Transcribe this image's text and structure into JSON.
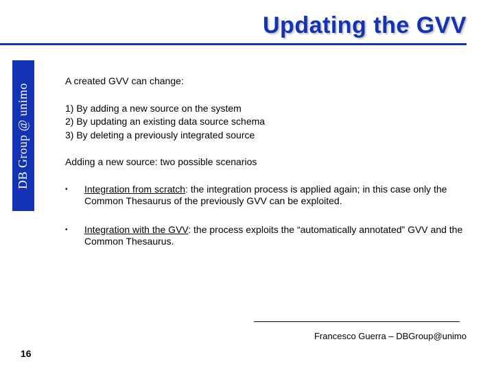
{
  "title": "Updating the GVV",
  "sidebar": "DB Group @ unimo",
  "intro": "A created GVV can change:",
  "numbered": [
    "1)  By adding a new source on the system",
    "2)  By updating an existing data source schema",
    "3)  By deleting a previously integrated source"
  ],
  "subheading": "Adding a new source: two possible scenarios",
  "bullets": [
    {
      "head": "Integration from scratch",
      "tail": ": the integration process is applied again; in this case only the Common Thesaurus of the previously GVV can be exploited."
    },
    {
      "head": "Integration  with the GVV",
      "tail": ": the process exploits the “automatically annotated” GVV and the Common Thesaurus."
    }
  ],
  "footer": "Francesco Guerra – DBGroup@unimo",
  "page": "16"
}
